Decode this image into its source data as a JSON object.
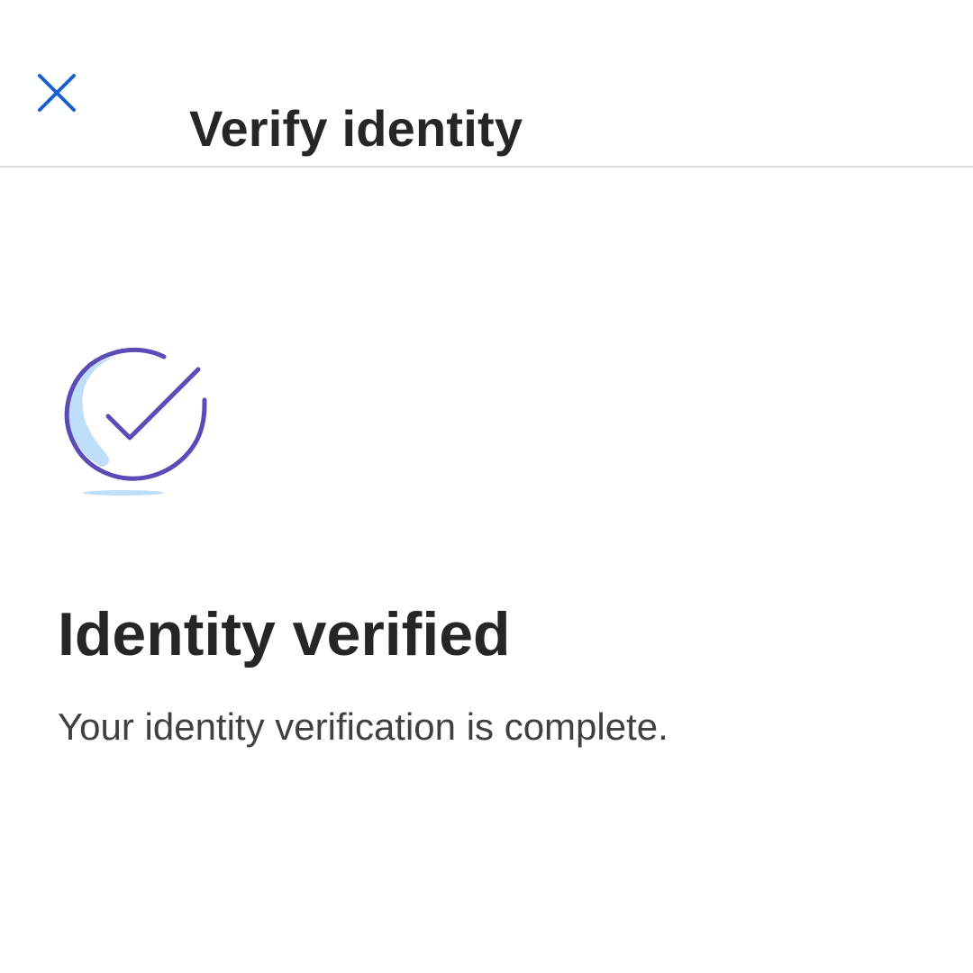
{
  "header": {
    "title": "Verify identity",
    "close_icon": "close-icon",
    "accent_color": "#1a5fd0"
  },
  "result": {
    "icon": "check-circle-icon",
    "heading": "Identity verified",
    "message": "Your identity verification is complete.",
    "icon_stroke_color": "#5a4bb7",
    "icon_fill_color": "#bfdefa"
  }
}
